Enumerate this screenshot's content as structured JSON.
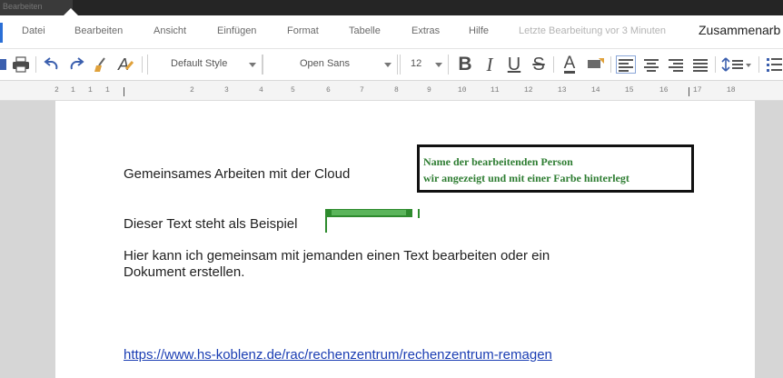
{
  "window": {
    "tab_title": "Bearbeiten"
  },
  "menubar": {
    "items": [
      "Datei",
      "Bearbeiten",
      "Ansicht",
      "Einfügen",
      "Format",
      "Tabelle",
      "Extras",
      "Hilfe"
    ],
    "status": "Letzte Bearbeitung vor 3 Minuten",
    "collaborate": "Zusammenarb"
  },
  "toolbar": {
    "style_select": "Default Style",
    "font_select": "Open Sans",
    "size_select": "12",
    "icons": [
      "save-icon",
      "print-icon",
      "undo-icon",
      "redo-icon",
      "clear-formatting-icon",
      "character-icon",
      "bold-icon",
      "italic-icon",
      "underline-icon",
      "strikethrough-icon",
      "font-color-icon",
      "highlight-icon",
      "align-left-icon",
      "align-center-icon",
      "align-right-icon",
      "justify-icon",
      "line-spacing-icon",
      "list-icon"
    ],
    "labels": {
      "bold": "B",
      "italic": "I",
      "underline": "U",
      "strike": "S",
      "font_color": "A",
      "character": "A"
    }
  },
  "ruler": {
    "marks": [
      "2",
      "1",
      "1",
      "1",
      "2",
      "3",
      "4",
      "5",
      "6",
      "7",
      "8",
      "9",
      "10",
      "11",
      "12",
      "13",
      "14",
      "15",
      "16",
      "17",
      "18"
    ]
  },
  "document": {
    "heading": "Gemeinsames Arbeiten mit der Cloud",
    "line1": "Dieser Text steht als Beispiel",
    "paragraph_line1": "Hier kann ich gemeinsam mit jemanden einen Text bearbeiten oder ein",
    "paragraph_line2": "Dokument erstellen.",
    "link": "https://www.hs-koblenz.de/rac/rechenzentrum/rechenzentrum-remagen"
  },
  "annotation": {
    "line1": "Name der bearbeitenden Person",
    "line2": "wir angezeigt und mit einer Farbe hinterlegt"
  },
  "colors": {
    "accent": "#2a6fd6",
    "collaborator": "#2e8b2e",
    "annotation_text": "#2e7d32",
    "link": "#1a3db3"
  }
}
